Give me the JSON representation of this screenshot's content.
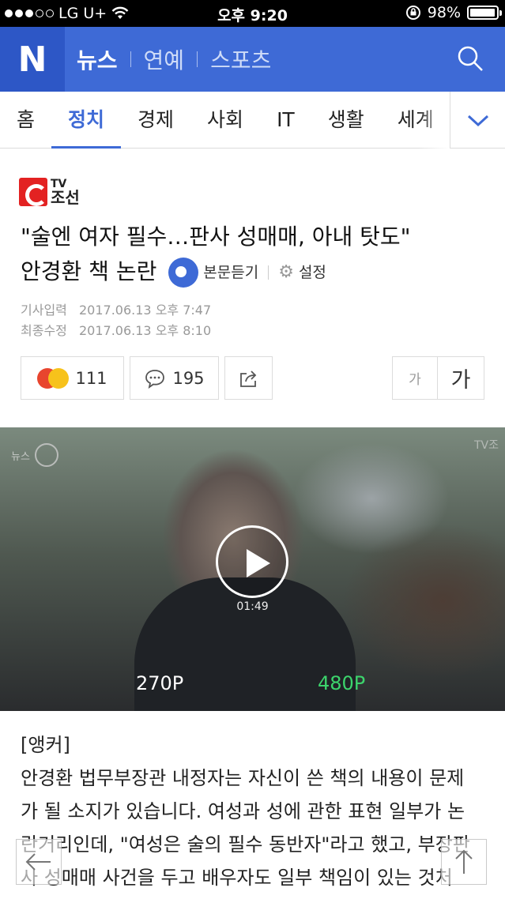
{
  "status_bar": {
    "carrier": "LG U+",
    "time": "오후 9:20",
    "battery": "98%",
    "battery_level": 0.98
  },
  "header": {
    "logo": "N",
    "nav": [
      {
        "label": "뉴스",
        "active": true
      },
      {
        "label": "연예",
        "active": false
      },
      {
        "label": "스포츠",
        "active": false
      }
    ],
    "search_icon": "search-icon"
  },
  "tabs": [
    {
      "label": "홈",
      "active": false
    },
    {
      "label": "정치",
      "active": true
    },
    {
      "label": "경제",
      "active": false
    },
    {
      "label": "사회",
      "active": false
    },
    {
      "label": "IT",
      "active": false
    },
    {
      "label": "생활",
      "active": false
    },
    {
      "label": "세계",
      "active": false
    }
  ],
  "article": {
    "press": {
      "tv": "TV",
      "name": "조선"
    },
    "title_line1": "\"술엔 여자 필수…판사 성매매, 아내 탓도\"",
    "title_line2": "안경환 책 논란",
    "listen_label": "본문듣기",
    "settings_label": "설정",
    "published_label": "기사입력",
    "published": "2017.06.13 오후 7:47",
    "modified_label": "최종수정",
    "modified": "2017.06.13 오후 8:10",
    "reactions": "111",
    "comments": "195",
    "font_small": "가",
    "font_large": "가",
    "video": {
      "duration": "01:49",
      "quality_low": "270P",
      "quality_high": "480P",
      "watermark_left": "뉴스",
      "watermark_right": "TV조"
    },
    "body_label": "[앵커]",
    "body_lines": [
      "안경환 법무부장관 내정자는 자신이 쓴 책의 내용이 문제",
      "가 될 소지가 있습니다. 여성과 성에 관한 표현 일부가 논",
      "란거리인데, \"여성은 술의 필수 동반자\"라고 했고, 부장판",
      "사 성매매 사건을 두고 배우자도 일부 책임이 있는 것처"
    ]
  },
  "colors": {
    "brand": "#3e6ad6",
    "brand_dark": "#2d57c6",
    "hd_quality": "#3cd46c"
  }
}
